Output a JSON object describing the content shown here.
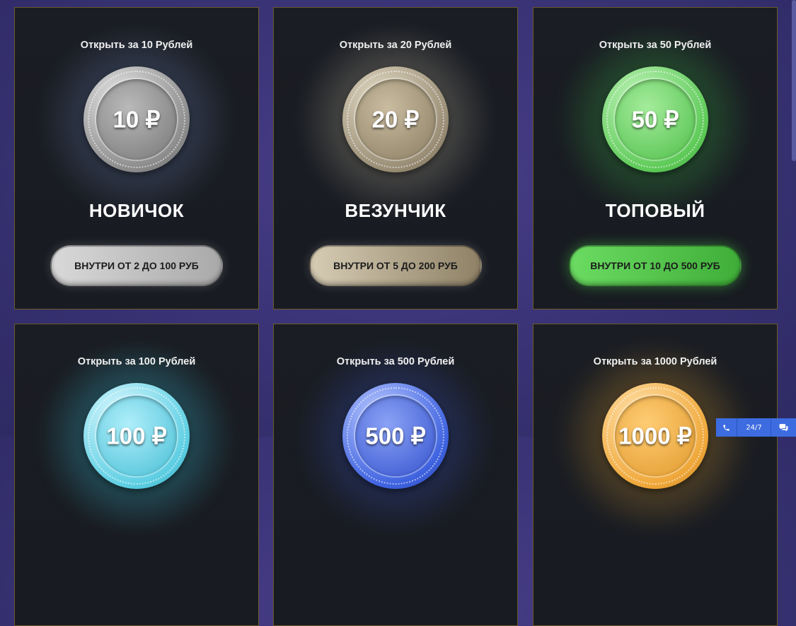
{
  "cards": [
    {
      "open_label": "Открыть за 10 Рублей",
      "coin_value": "10 ₽",
      "name": "НОВИЧОК",
      "button": "ВНУТРИ ОТ 2 ДО 100 РУБ",
      "coin_color": "#9a9a9a",
      "glow": "#6f86b8",
      "btn_color": "#c9c9c9"
    },
    {
      "open_label": "Открыть за 20 Рублей",
      "coin_value": "20 ₽",
      "name": "ВЕЗУНЧИК",
      "button": "ВНУТРИ ОТ 5 ДО 200 РУБ",
      "coin_color": "#a79b83",
      "glow": "#c9c0a6",
      "btn_color": "#bfb39a"
    },
    {
      "open_label": "Открыть за 50 Рублей",
      "coin_value": "50 ₽",
      "name": "ТОПОВЫЙ",
      "button": "ВНУТРИ ОТ 10 ДО 500 РУБ",
      "coin_color": "#6fd66a",
      "glow": "#3fc24a",
      "btn_color": "#5ccd55"
    },
    {
      "open_label": "Открыть за 100 Рублей",
      "coin_value": "100 ₽",
      "name": "",
      "button": "",
      "coin_color": "#6fd8e8",
      "glow": "#3fd0e8",
      "btn_color": "#6fd8e8"
    },
    {
      "open_label": "Открыть за 500 Рублей",
      "coin_value": "500 ₽",
      "name": "",
      "button": "",
      "coin_color": "#3f63e0",
      "glow": "#3a56c8",
      "btn_color": "#3f63e0"
    },
    {
      "open_label": "Открыть за 1000 Рублей",
      "coin_value": "1000 ₽",
      "name": "",
      "button": "",
      "coin_color": "#f0a83a",
      "glow": "#e0a030",
      "btn_color": "#f0a83a"
    }
  ],
  "widget": {
    "phone_icon": "phone-icon",
    "label": "24/7",
    "chat_icon": "chat-icon"
  }
}
